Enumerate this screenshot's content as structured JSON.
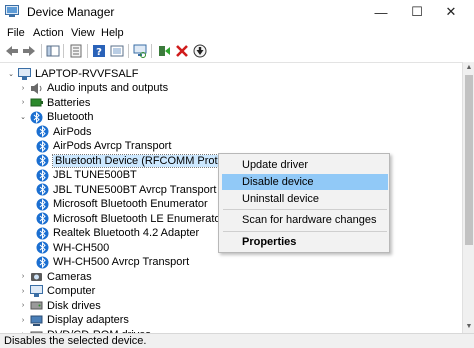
{
  "window": {
    "title": "Device Manager",
    "minimize": "—",
    "maximize": "☐",
    "close": "✕"
  },
  "menu": [
    "File",
    "Action",
    "View",
    "Help"
  ],
  "tree": {
    "root": "LAPTOP-RVVFSALF",
    "rows": [
      {
        "label": "Audio inputs and outputs",
        "expander": "›",
        "icon": "speaker-icon"
      },
      {
        "label": "Batteries",
        "expander": "›",
        "icon": "battery-icon"
      },
      {
        "label": "Bluetooth",
        "expander": "⌄",
        "icon": "bluetooth-icon"
      },
      {
        "label": "AirPods",
        "icon": "bluetooth-icon"
      },
      {
        "label": "AirPods Avrcp Transport",
        "icon": "bluetooth-icon"
      },
      {
        "label": "Bluetooth Device (RFCOMM Protocol TDI)",
        "icon": "bluetooth-icon",
        "selected": true
      },
      {
        "label": "JBL TUNE500BT",
        "icon": "bluetooth-icon"
      },
      {
        "label": "JBL TUNE500BT Avrcp Transport",
        "icon": "bluetooth-icon"
      },
      {
        "label": "Microsoft Bluetooth Enumerator",
        "icon": "bluetooth-icon"
      },
      {
        "label": "Microsoft Bluetooth LE Enumerator",
        "icon": "bluetooth-icon"
      },
      {
        "label": "Realtek Bluetooth 4.2 Adapter",
        "icon": "bluetooth-icon"
      },
      {
        "label": "WH-CH500",
        "icon": "bluetooth-icon"
      },
      {
        "label": "WH-CH500 Avrcp Transport",
        "icon": "bluetooth-icon"
      },
      {
        "label": "Cameras",
        "expander": "›",
        "icon": "camera-icon"
      },
      {
        "label": "Computer",
        "expander": "›",
        "icon": "computer-icon"
      },
      {
        "label": "Disk drives",
        "expander": "›",
        "icon": "disk-icon"
      },
      {
        "label": "Display adapters",
        "expander": "›",
        "icon": "display-icon"
      },
      {
        "label": "DVD/CD-ROM drives",
        "expander": "›",
        "icon": "dvd-icon"
      }
    ]
  },
  "context_menu": {
    "items": [
      "Update driver",
      "Disable device",
      "Uninstall device",
      "Scan for hardware changes",
      "Properties"
    ],
    "highlighted": "Disable device"
  },
  "status": "Disables the selected device.",
  "colors": {
    "bluetooth": "#1b6fd1",
    "selection": "#cce8ff",
    "menu_highlight": "#91c9f7"
  }
}
